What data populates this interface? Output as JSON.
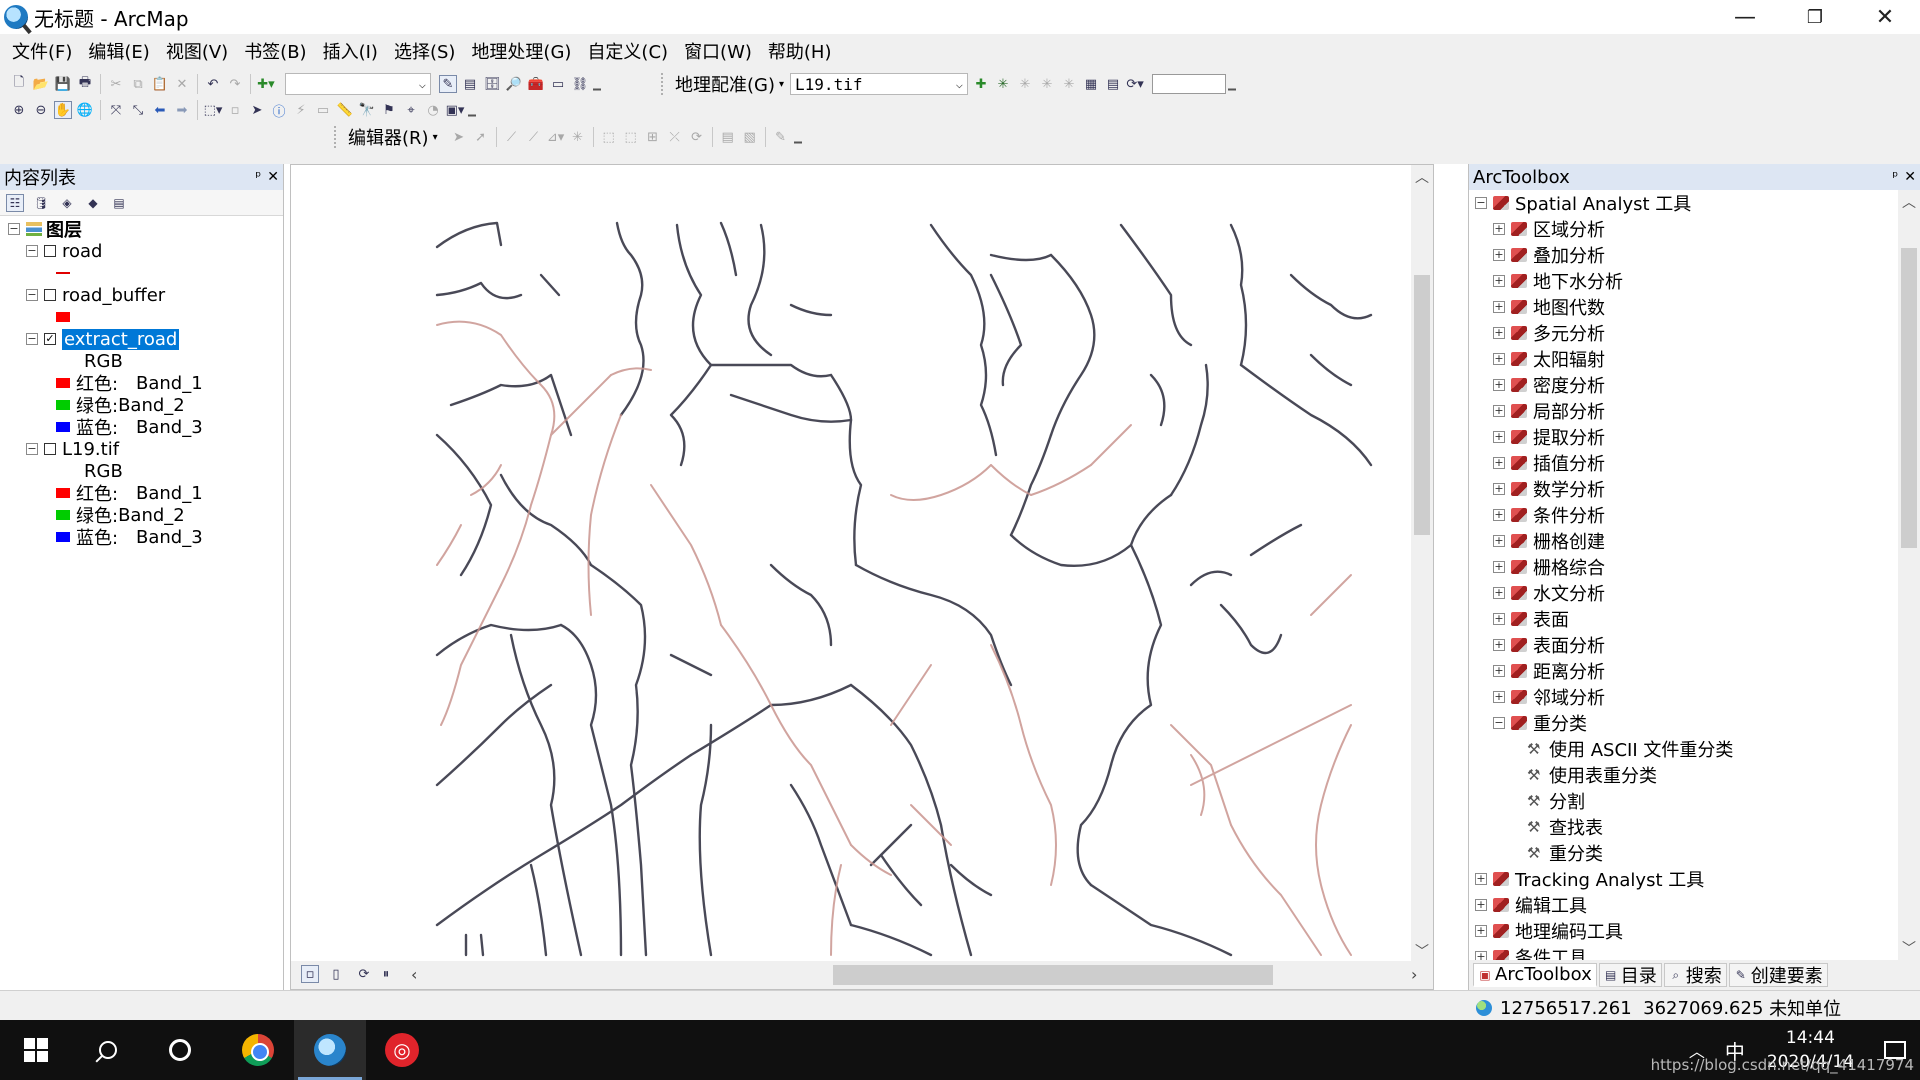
{
  "window": {
    "title": "无标题 - ArcMap",
    "controls": {
      "minimize": "—",
      "restore": "❐",
      "close": "✕"
    }
  },
  "menu": [
    "文件(F)",
    "编辑(E)",
    "视图(V)",
    "书签(B)",
    "插入(I)",
    "选择(S)",
    "地理处理(G)",
    "自定义(C)",
    "窗口(W)",
    "帮助(H)"
  ],
  "toolbar": {
    "scale_value": "",
    "georef_label": "地理配准(G)",
    "georef_layer": "L19.tif",
    "georef_input_value": "",
    "editor_label": "编辑器(R)"
  },
  "toc": {
    "title": "内容列表",
    "pin": "ᵖ",
    "close": "✕",
    "root_label": "图层",
    "layers": [
      {
        "name": "road",
        "checked": false,
        "symbol": "line",
        "symbol_color": "#e00000"
      },
      {
        "name": "road_buffer",
        "checked": false,
        "symbol": "fill",
        "symbol_color": "#ff0000"
      },
      {
        "name": "extract_road",
        "checked": true,
        "selected": true,
        "render": "RGB",
        "bands": [
          {
            "label": "红色:",
            "band": "Band_1",
            "color": "#ff0000"
          },
          {
            "label": "绿色:",
            "band": "Band_2",
            "color": "#00cc00"
          },
          {
            "label": "蓝色:",
            "band": "Band_3",
            "color": "#0000ff"
          }
        ]
      },
      {
        "name": "L19.tif",
        "checked": false,
        "render": "RGB",
        "bands": [
          {
            "label": "红色:",
            "band": "Band_1",
            "color": "#ff0000"
          },
          {
            "label": "绿色:",
            "band": "Band_2",
            "color": "#00cc00"
          },
          {
            "label": "蓝色:",
            "band": "Band_3",
            "color": "#0000ff"
          }
        ]
      }
    ]
  },
  "arctoolbox": {
    "title": "ArcToolbox",
    "pin": "ᵖ",
    "close": "✕",
    "root": "Spatial Analyst 工具",
    "toolsets": [
      "区域分析",
      "叠加分析",
      "地下水分析",
      "地图代数",
      "多元分析",
      "太阳辐射",
      "密度分析",
      "局部分析",
      "提取分析",
      "插值分析",
      "数学分析",
      "条件分析",
      "栅格创建",
      "栅格综合",
      "水文分析",
      "表面",
      "表面分析",
      "距离分析",
      "邻域分析"
    ],
    "expanded_toolset": "重分类",
    "tools": [
      "使用 ASCII 文件重分类",
      "使用表重分类",
      "分割",
      "查找表",
      "重分类"
    ],
    "other_toolboxes": [
      "Tracking Analyst 工具",
      "编辑工具",
      "地理编码工具",
      "条件工具"
    ],
    "tabs": [
      "ArcToolbox",
      "目录",
      "搜索",
      "创建要素"
    ]
  },
  "status": {
    "x": "12756517.261",
    "y": "3627069.625",
    "units": "未知单位"
  },
  "taskbar": {
    "ime": "中",
    "time": "14:44",
    "date": "2020/4/14",
    "watermark": "https://blog.csdn.net/qq_41417974"
  }
}
